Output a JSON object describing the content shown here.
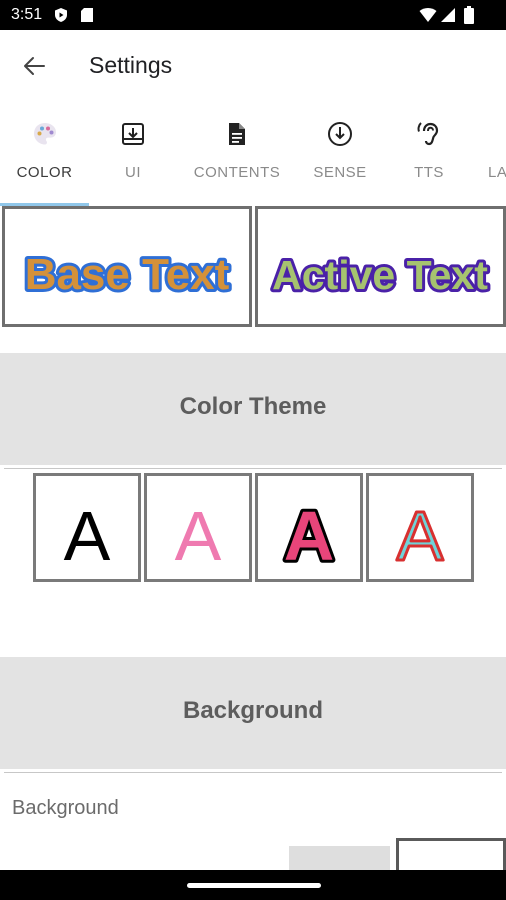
{
  "status_bar": {
    "time": "3:51",
    "icons_left": [
      "play-protect-icon",
      "sd-card-icon"
    ],
    "icons_right": [
      "wifi-icon",
      "signal-icon",
      "battery-icon"
    ]
  },
  "app_bar": {
    "back_icon": "arrow-back-icon",
    "title": "Settings"
  },
  "tabs": [
    {
      "label": "COLOR",
      "icon": "palette-icon",
      "active": true
    },
    {
      "label": "UI",
      "icon": "download-box-icon",
      "active": false
    },
    {
      "label": "CONTENTS",
      "icon": "document-icon",
      "active": false
    },
    {
      "label": "SENSE",
      "icon": "arrow-circle-down-icon",
      "active": false
    },
    {
      "label": "TTS",
      "icon": "hearing-icon",
      "active": false
    },
    {
      "label": "LA",
      "icon": "",
      "active": false
    }
  ],
  "previews": {
    "base": {
      "text": "Base Text",
      "fill": "#d4913a",
      "stroke": "#2f6fd6"
    },
    "active": {
      "text": "Active Text",
      "fill": "#a6c36f",
      "stroke": "#4a21a8"
    }
  },
  "color_theme": {
    "title": "Color Theme",
    "options": [
      {
        "letter": "A",
        "fill": "#000000",
        "stroke": "none"
      },
      {
        "letter": "A",
        "fill": "#ef7ab0",
        "stroke": "#ef7ab0"
      },
      {
        "letter": "A",
        "fill": "#e8457a",
        "stroke": "#000000"
      },
      {
        "letter": "A",
        "fill": "#6fd3d8",
        "stroke": "#d83030"
      }
    ]
  },
  "background": {
    "title": "Background",
    "label": "Background",
    "swatches": [
      "#dedede",
      "#ffffff"
    ]
  },
  "colors": {
    "tab_indicator": "#90c7ea",
    "section_bg": "#e3e3e3",
    "status_bar": "#000000"
  }
}
